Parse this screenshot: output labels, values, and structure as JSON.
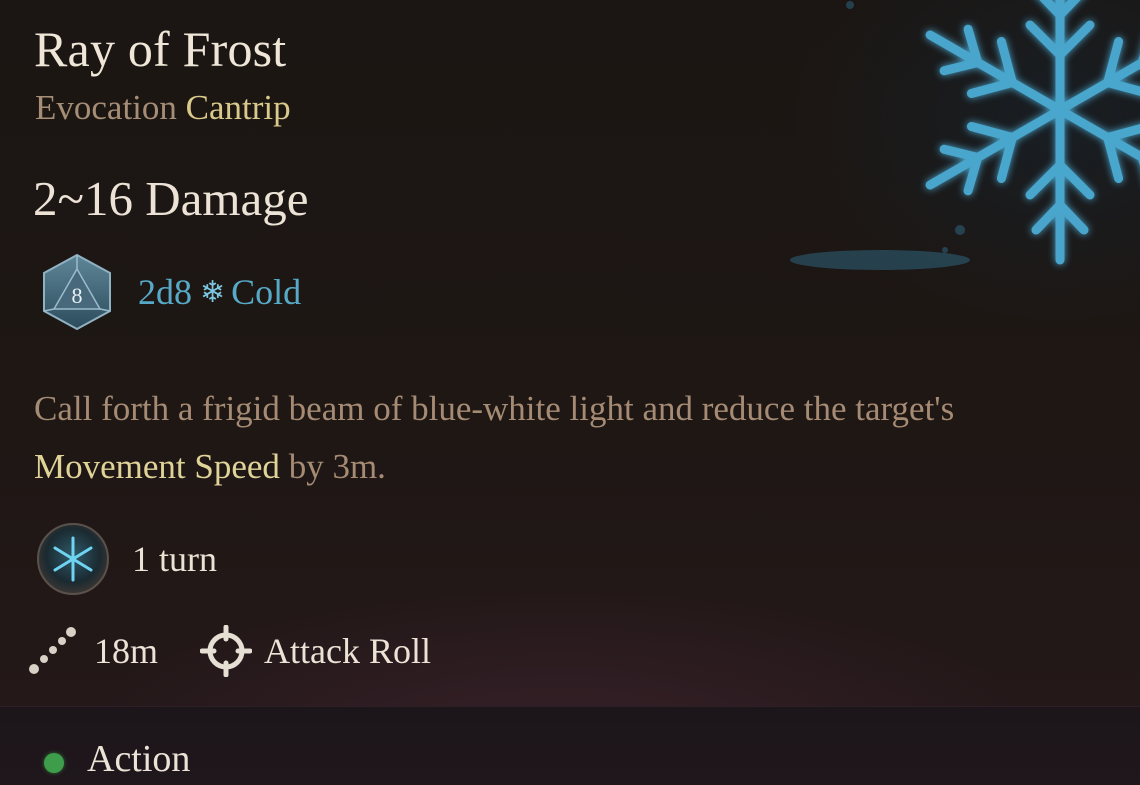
{
  "spell": {
    "name": "Ray of Frost",
    "school": "Evocation",
    "level": "Cantrip",
    "damage_range": "2~16 Damage",
    "die_face": "8",
    "dice": "2d8",
    "damage_type_icon": "snowflake-icon",
    "damage_type": "Cold",
    "description": {
      "part1": "Call forth a frigid beam of blue-white light and reduce the target's ",
      "highlight": "Movement Speed",
      "part2": " by 3m."
    },
    "duration": "1 turn",
    "range": "18m",
    "attack": "Attack Roll",
    "cost": "Action"
  },
  "colors": {
    "title": "#efe6d8",
    "school": "#a58d76",
    "level": "#d9c98a",
    "dice": "#57a9c8",
    "highlight": "#e0d398",
    "action_dot": "#3d9d4a"
  }
}
